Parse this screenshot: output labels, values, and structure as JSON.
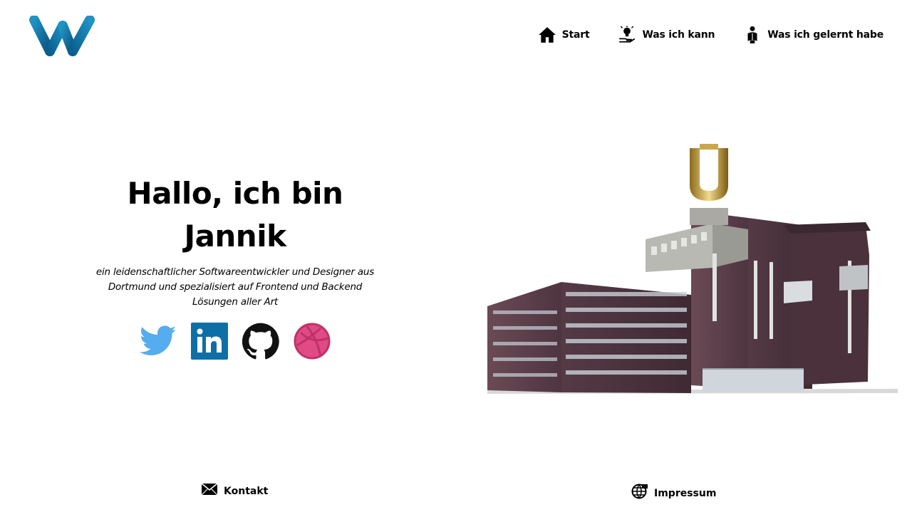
{
  "header": {
    "nav": [
      {
        "label": "Start",
        "icon": "home-icon"
      },
      {
        "label": "Was ich kann",
        "icon": "lightbulb-hand-icon"
      },
      {
        "label": "Was ich gelernt habe",
        "icon": "reading-person-icon"
      }
    ]
  },
  "hero": {
    "title_line1": "Hallo, ich bin",
    "title_line2": "Jannik",
    "subtitle": "ein leidenschaftlicher Softwareentwickler und Designer aus Dortmund und spezialisiert auf Frontend und Backend Lösungen aller Art"
  },
  "socials": [
    {
      "name": "twitter",
      "icon": "twitter-icon",
      "color": "#55acee"
    },
    {
      "name": "linkedin",
      "icon": "linkedin-icon",
      "color": "#0e6fa6"
    },
    {
      "name": "github",
      "icon": "github-icon",
      "color": "#111111"
    },
    {
      "name": "dribbble",
      "icon": "dribbble-icon",
      "color": "#e04a86"
    }
  ],
  "footer": {
    "contact_label": "Kontakt",
    "imprint_label": "Impressum"
  },
  "colors": {
    "logo_blue_dark": "#0a4f7a",
    "logo_blue_light": "#1f93c4",
    "brick": "#5a3d45"
  }
}
